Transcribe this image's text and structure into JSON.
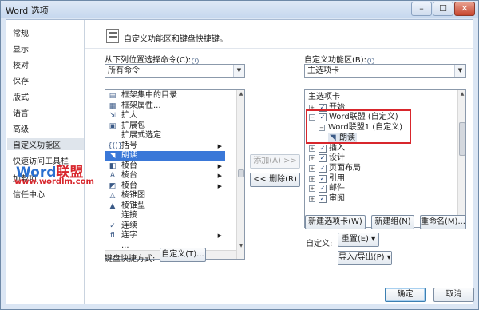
{
  "window": {
    "title": "Word 选项",
    "controls": {
      "minimize": "–",
      "maximize": "☐",
      "close": "✕"
    }
  },
  "nav": {
    "items": [
      {
        "label": "常规"
      },
      {
        "label": "显示"
      },
      {
        "label": "校对"
      },
      {
        "label": "保存"
      },
      {
        "label": "版式"
      },
      {
        "label": "语言"
      },
      {
        "label": "高级"
      },
      {
        "label": "自定义功能区",
        "selected": true
      },
      {
        "label": "快速访问工具栏"
      },
      {
        "label": "加载项"
      },
      {
        "label": "信任中心"
      }
    ]
  },
  "header": {
    "text": "自定义功能区和键盘快捷键。"
  },
  "left_panel": {
    "choose_label": "从下列位置选择命令(C):",
    "choose_value": "所有命令",
    "commands": [
      {
        "icon": "table-of-contents-icon",
        "glyph": "▤",
        "label": "框架集中的目录"
      },
      {
        "icon": "frame-properties-icon",
        "glyph": "▦",
        "label": "框架属性..."
      },
      {
        "icon": "expand-icon",
        "glyph": "⇲",
        "label": "扩大"
      },
      {
        "icon": "expand-pack-icon",
        "glyph": "▣",
        "label": "扩展包"
      },
      {
        "icon": "blank-icon",
        "glyph": "",
        "label": "扩展式选定"
      },
      {
        "icon": "brackets-icon",
        "glyph": "{()}",
        "label": "括号",
        "submenu": true
      },
      {
        "icon": "read-aloud-icon",
        "glyph": "◥",
        "label": "朗读",
        "selected": true
      },
      {
        "icon": "prism-icon",
        "glyph": "◧",
        "label": "棱台",
        "submenu": true
      },
      {
        "icon": "bevel-text-icon",
        "glyph": "A",
        "label": "棱台",
        "submenu": true
      },
      {
        "icon": "bevel-shape-icon",
        "glyph": "◩",
        "label": "棱台",
        "submenu": true
      },
      {
        "icon": "pyramid-chart-icon",
        "glyph": "△",
        "label": "棱锥图"
      },
      {
        "icon": "pyramid-icon",
        "glyph": "▲",
        "label": "棱锥型"
      },
      {
        "icon": "blank-icon",
        "glyph": "",
        "label": "连接"
      },
      {
        "icon": "check-icon",
        "glyph": "✓",
        "label": "连续"
      },
      {
        "icon": "ligature-icon",
        "glyph": "ﬁ",
        "label": "连字",
        "submenu": true
      },
      {
        "icon": "blank-icon",
        "glyph": "",
        "label": "..."
      }
    ],
    "keyboard_label": "键盘快捷方式:",
    "keyboard_button": "自定义(T)..."
  },
  "middle": {
    "add_button": "添加(A) >>",
    "remove_button": "<< 删除(R)"
  },
  "right_panel": {
    "ribbon_label": "自定义功能区(B):",
    "ribbon_value": "主选项卡",
    "tree": [
      {
        "label": "主选项卡",
        "level": 0,
        "kind": "header"
      },
      {
        "label": "开始",
        "level": 1,
        "expander": "+",
        "checked": true
      },
      {
        "label": "Word联盟 (自定义)",
        "level": 1,
        "expander": "−",
        "checked": true
      },
      {
        "label": "Word联盟1 (自定义)",
        "level": 2,
        "expander": "−"
      },
      {
        "label": "朗读",
        "level": 3,
        "icon": "read-aloud-icon",
        "selected": true
      },
      {
        "label": "插入",
        "level": 1,
        "expander": "+",
        "checked": true
      },
      {
        "label": "设计",
        "level": 1,
        "expander": "+",
        "checked": true
      },
      {
        "label": "页面布局",
        "level": 1,
        "expander": "+",
        "checked": true
      },
      {
        "label": "引用",
        "level": 1,
        "expander": "+",
        "checked": true
      },
      {
        "label": "邮件",
        "level": 1,
        "expander": "+",
        "checked": true
      },
      {
        "label": "审阅",
        "level": 1,
        "expander": "+",
        "checked": true
      }
    ],
    "new_tab_button": "新建选项卡(W)",
    "new_group_button": "新建组(N)",
    "rename_button": "重命名(M)...",
    "customize_label": "自定义:",
    "reset_button": "重置(E) ▾",
    "import_export_button": "导入/导出(P) ▾"
  },
  "footer": {
    "ok_button": "确定",
    "cancel_button": "取消"
  },
  "watermark": {
    "brand_en": "Word",
    "brand_cn": "联盟",
    "url": "www.wordlm.com"
  },
  "colors": {
    "accent_selection": "#3a78d8",
    "highlight_border": "#d8262c",
    "window_frame": "#dbe6f4"
  }
}
